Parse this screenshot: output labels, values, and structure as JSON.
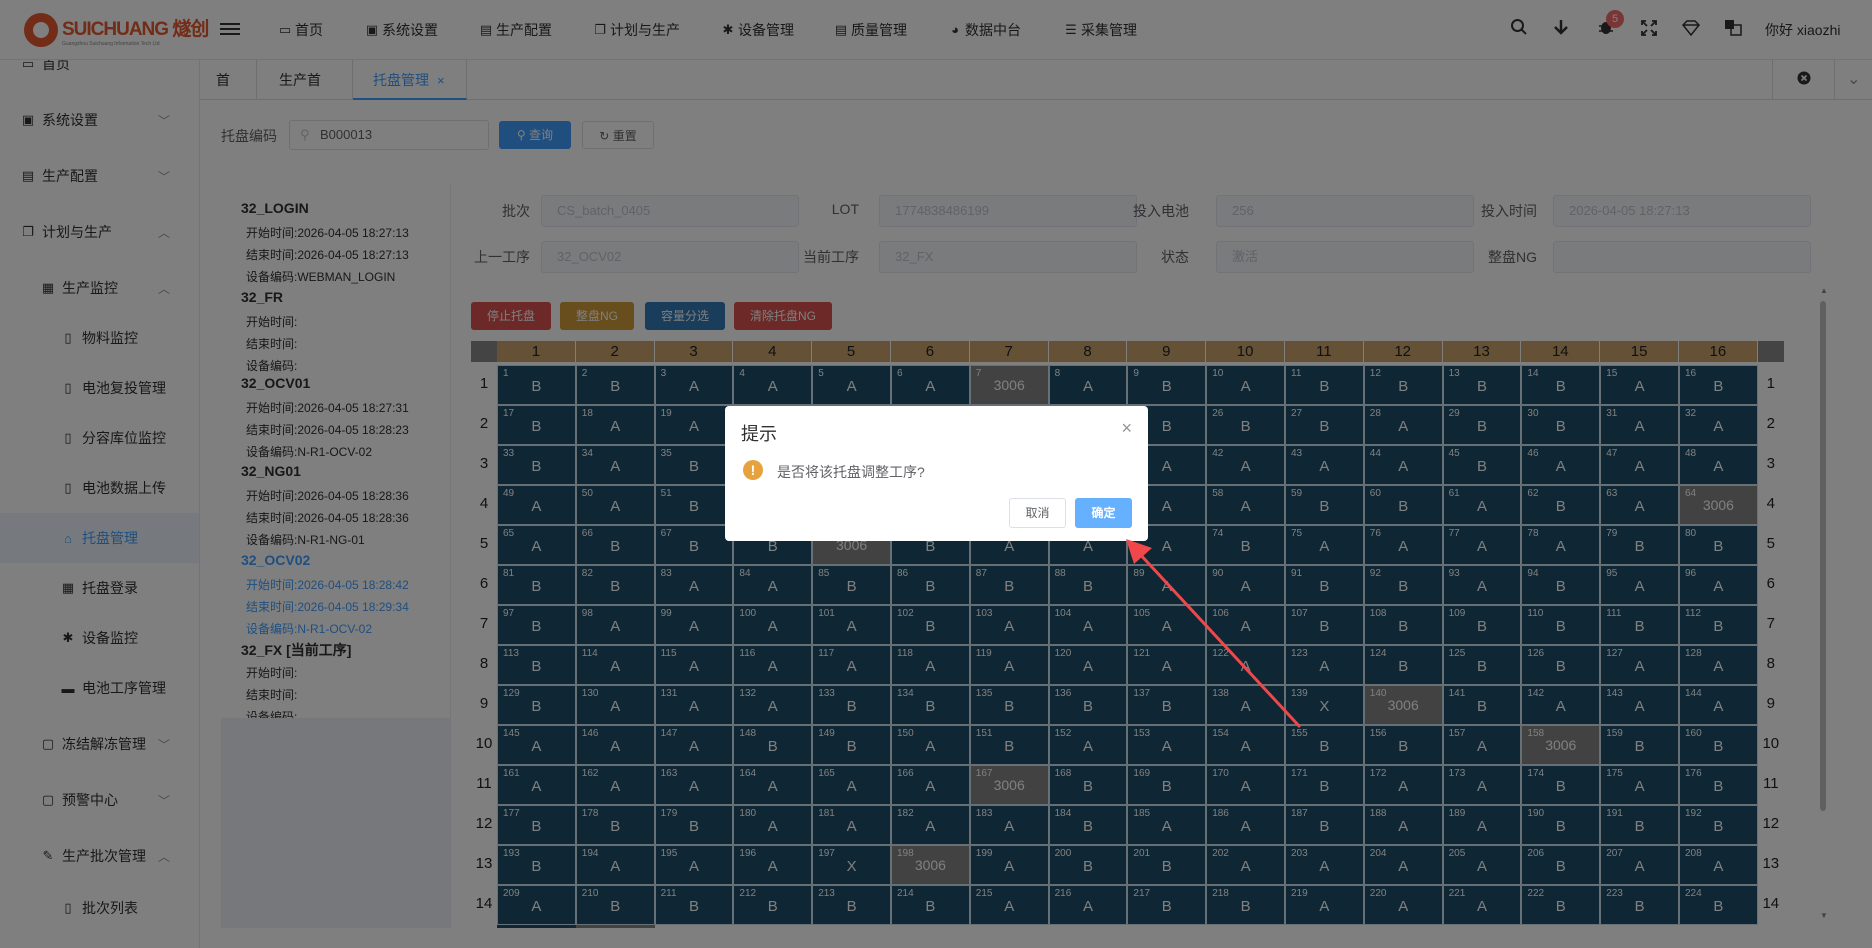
{
  "header": {
    "logo_main": "SUICHUANG 燧创",
    "logo_sub": "Guangzhou Suichuang Information Tech Ltd",
    "nav": [
      {
        "icon": "monitor-icon",
        "label": "首页"
      },
      {
        "icon": "user-icon",
        "label": "系统设置"
      },
      {
        "icon": "briefcase-icon",
        "label": "生产配置"
      },
      {
        "icon": "copy-icon",
        "label": "计划与生产"
      },
      {
        "icon": "gear-icon",
        "label": "设备管理"
      },
      {
        "icon": "briefcase-icon",
        "label": "质量管理"
      },
      {
        "icon": "pie-chart-icon",
        "label": "数据中台"
      },
      {
        "icon": "database-icon",
        "label": "采集管理"
      }
    ],
    "badge": "5",
    "greeting": "你好 xiaozhi"
  },
  "sidebar": [
    {
      "label": "首页",
      "icon": "monitor-icon",
      "arrow": ""
    },
    {
      "label": "系统设置",
      "icon": "user-icon",
      "arrow": "down"
    },
    {
      "label": "生产配置",
      "icon": "briefcase-icon",
      "arrow": "down"
    },
    {
      "label": "计划与生产",
      "icon": "copy-icon",
      "arrow": "up"
    },
    {
      "label": "生产监控",
      "icon": "server-icon",
      "arrow": "up"
    },
    {
      "label": "物料监控",
      "icon": "file-icon",
      "arrow": ""
    },
    {
      "label": "电池复投管理",
      "icon": "file-icon",
      "arrow": ""
    },
    {
      "label": "分容库位监控",
      "icon": "file-icon",
      "arrow": ""
    },
    {
      "label": "电池数据上传",
      "icon": "file-icon",
      "arrow": ""
    },
    {
      "label": "托盘管理",
      "icon": "basket-icon",
      "arrow": ""
    },
    {
      "label": "托盘登录",
      "icon": "table-icon",
      "arrow": ""
    },
    {
      "label": "设备监控",
      "icon": "gear-icon",
      "arrow": ""
    },
    {
      "label": "电池工序管理",
      "icon": "battery-icon",
      "arrow": ""
    },
    {
      "label": "冻结解冻管理",
      "icon": "folder-icon",
      "arrow": "down"
    },
    {
      "label": "预警中心",
      "icon": "folder-icon",
      "arrow": "down"
    },
    {
      "label": "生产批次管理",
      "icon": "edit-icon",
      "arrow": "up"
    },
    {
      "label": "批次列表",
      "icon": "file-icon",
      "arrow": ""
    }
  ],
  "tabs": [
    {
      "label": "首页"
    },
    {
      "label": "生产首页"
    },
    {
      "label": "托盘管理",
      "close": "×"
    }
  ],
  "search": {
    "label": "托盘编码",
    "value": "B000013",
    "query": "查询",
    "reset": "重置"
  },
  "tree": [
    {
      "title": "32_LOGIN",
      "start": "开始时间:2026-04-05 18:27:13",
      "end": "结束时间:2026-04-05 18:27:13",
      "dev": "设备编码:WEBMAN_LOGIN"
    },
    {
      "title": "32_FR",
      "start": "开始时间:",
      "end": "结束时间:",
      "dev": "设备编码:"
    },
    {
      "title": "32_OCV01",
      "start": "开始时间:2026-04-05 18:27:31",
      "end": "结束时间:2026-04-05 18:28:23",
      "dev": "设备编码:N-R1-OCV-02"
    },
    {
      "title": "32_NG01",
      "start": "开始时间:2026-04-05 18:28:36",
      "end": "结束时间:2026-04-05 18:28:36",
      "dev": "设备编码:N-R1-NG-01"
    },
    {
      "title": "32_OCV02",
      "start": "开始时间:2026-04-05 18:28:42",
      "end": "结束时间:2026-04-05 18:29:34",
      "dev": "设备编码:N-R1-OCV-02",
      "current": true
    },
    {
      "title": "32_FX [当前工序]",
      "start": "开始时间:",
      "end": "结束时间:",
      "dev": "设备编码:"
    }
  ],
  "info": [
    {
      "label": "批次",
      "value": "CS_batch_0405"
    },
    {
      "label": "LOT",
      "value": "1774838486199"
    },
    {
      "label": "投入电池",
      "value": "256"
    },
    {
      "label": "投入时间",
      "value": "2026-04-05 18:27:13"
    },
    {
      "label": "上一工序",
      "value": "32_OCV02"
    },
    {
      "label": "当前工序",
      "value": "32_FX"
    },
    {
      "label": "状态",
      "value": "激活"
    },
    {
      "label": "整盘NG",
      "value": ""
    }
  ],
  "actions": [
    {
      "label": "停止托盘",
      "color": "#d9534f"
    },
    {
      "label": "整盘NG",
      "color": "#d09a3a"
    },
    {
      "label": "容量分选",
      "color": "#337ab7"
    },
    {
      "label": "清除托盘NG",
      "color": "#d9534f"
    }
  ],
  "grid": {
    "columns": [
      "1",
      "2",
      "3",
      "4",
      "5",
      "6",
      "7",
      "8",
      "9",
      "10",
      "11",
      "12",
      "13",
      "14",
      "15",
      "16"
    ],
    "rows": [
      "1",
      "2",
      "3",
      "4",
      "5",
      "6",
      "7",
      "8",
      "9",
      "10",
      "11",
      "12",
      "13",
      "14"
    ],
    "values": "BBAAAAXABABBBBAB BAAABABBBBBABBAA BABABBBAAAAABAAA AABAABAAAABBABAX ABBBXBAAABAAAABB BBAABBBBAABBABAA BAAAABAAAABBBBBB BAAAAAAAAAABBBAA BAAABBBBBAXABAAA AAABBABAAABBABBB AAAAAABBBABAABAB BBBAAAABAABAABBB BAAAXAABBAAAABAA ABBBBBAABBAAABBB",
    "occupied": {
      "7": "3006",
      "64": "3006",
      "69": "3006",
      "140": "3006",
      "158": "3006",
      "167": "3006",
      "198": "3006"
    }
  },
  "dialog": {
    "title": "提示",
    "message": "是否将该托盘调整工序?",
    "cancel": "取消",
    "ok": "确定",
    "close": "×"
  }
}
